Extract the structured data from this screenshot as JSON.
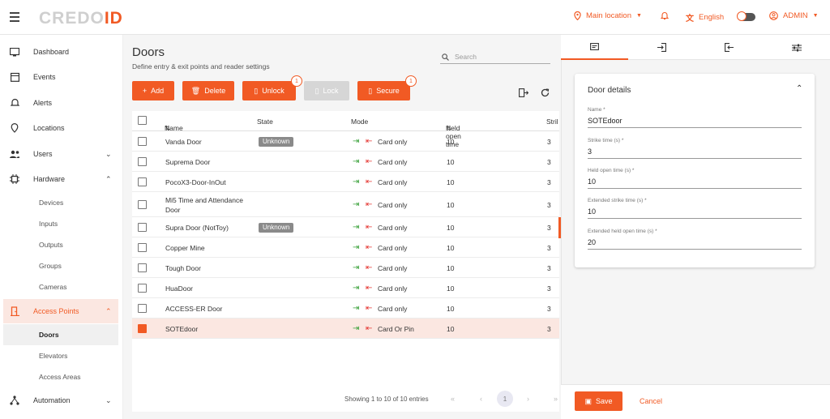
{
  "app": {
    "logo_a": "CREDO",
    "logo_b": "ID"
  },
  "topbar": {
    "location": "Main location",
    "language": "English",
    "user": "ADMIN"
  },
  "sidebar": {
    "items": [
      {
        "label": "Dashboard"
      },
      {
        "label": "Events"
      },
      {
        "label": "Alerts"
      },
      {
        "label": "Locations"
      },
      {
        "label": "Users"
      },
      {
        "label": "Hardware"
      },
      {
        "label": "Access Points"
      },
      {
        "label": "Automation"
      }
    ],
    "hardware_sub": [
      "Devices",
      "Inputs",
      "Outputs",
      "Groups",
      "Cameras"
    ],
    "access_sub": [
      "Doors",
      "Elevators",
      "Access Areas"
    ]
  },
  "page": {
    "title": "Doors",
    "subtitle": "Define entry & exit points and reader settings",
    "search_placeholder": "Search"
  },
  "toolbar": {
    "add": "Add",
    "delete": "Delete",
    "unlock": "Unlock",
    "unlock_badge": "1",
    "lock": "Lock",
    "secure": "Secure",
    "secure_badge": "1"
  },
  "table": {
    "headers": {
      "name": "Name",
      "state": "State",
      "mode": "Mode",
      "held": "Held open time",
      "strike": "Stril"
    },
    "rows": [
      {
        "name": "Vanda Door",
        "state": "Unknown",
        "mode": "Card only",
        "held": "10",
        "strike": "3"
      },
      {
        "name": "Suprema Door",
        "state": "",
        "mode": "Card only",
        "held": "10",
        "strike": "3"
      },
      {
        "name": "PocoX3-Door-InOut",
        "state": "",
        "mode": "Card only",
        "held": "10",
        "strike": "3"
      },
      {
        "name": "Mi5 Time and Attendance",
        "name2": "Door",
        "state": "",
        "mode": "Card only",
        "held": "10",
        "strike": "3"
      },
      {
        "name": "Supra Door (NotToy)",
        "state": "Unknown",
        "mode": "Card only",
        "held": "10",
        "strike": "3"
      },
      {
        "name": "Copper Mine",
        "state": "",
        "mode": "Card only",
        "held": "10",
        "strike": "3"
      },
      {
        "name": "Tough Door",
        "state": "",
        "mode": "Card only",
        "held": "10",
        "strike": "3"
      },
      {
        "name": "HuaDoor",
        "state": "",
        "mode": "Card only",
        "held": "10",
        "strike": "3"
      },
      {
        "name": "ACCESS-ER Door",
        "state": "",
        "mode": "Card only",
        "held": "10",
        "strike": "3"
      },
      {
        "name": "SOTEdoor",
        "state": "",
        "mode": "Card Or Pin",
        "held": "10",
        "strike": "3"
      }
    ],
    "footer": "Showing 1 to 10 of 10 entries",
    "page": "1"
  },
  "details": {
    "title": "Door details",
    "fields": [
      {
        "label": "Name *",
        "value": "SOTEdoor"
      },
      {
        "label": "Strike time (s) *",
        "value": "3"
      },
      {
        "label": "Held open time (s) *",
        "value": "10"
      },
      {
        "label": "Extended strike time (s) *",
        "value": "10"
      },
      {
        "label": "Extended held open time (s) *",
        "value": "20"
      }
    ]
  },
  "actions": {
    "save": "Save",
    "cancel": "Cancel"
  },
  "colors": {
    "accent": "#f15a24",
    "selected_row": "#fbe7e1",
    "chip": "#8a8a8a"
  }
}
